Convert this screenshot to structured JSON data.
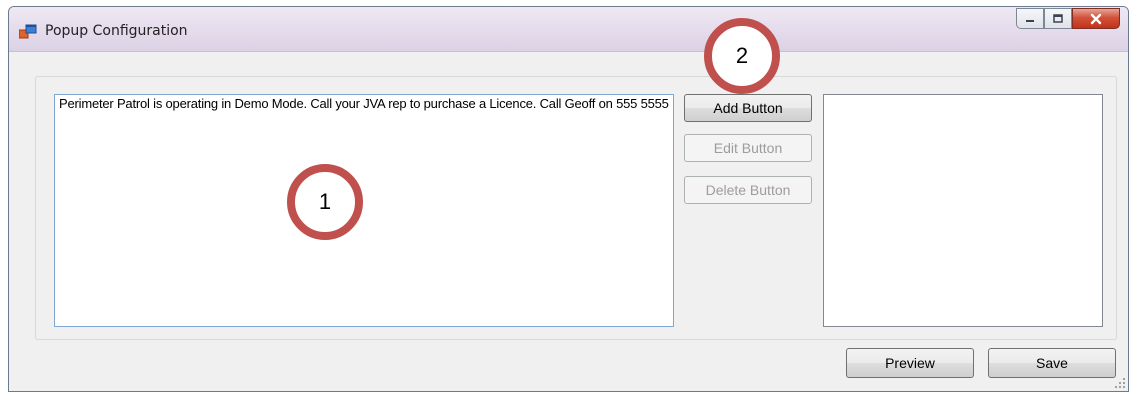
{
  "window": {
    "title": "Popup Configuration"
  },
  "message": {
    "text": "Perimeter Patrol is operating in Demo Mode. Call your JVA rep to purchase a Licence. Call Geoff on 555 5555"
  },
  "buttons": {
    "add": "Add Button",
    "edit": "Edit Button",
    "delete": "Delete Button",
    "preview": "Preview",
    "save": "Save"
  },
  "annotations": {
    "marker_1": "1",
    "marker_2": "2",
    "color": "#c0504d"
  },
  "icons": {
    "app": "window-app-icon",
    "minimize": "minimize-icon",
    "maximize": "maximize-icon",
    "close": "close-icon",
    "resize": "resize-grip-icon"
  }
}
